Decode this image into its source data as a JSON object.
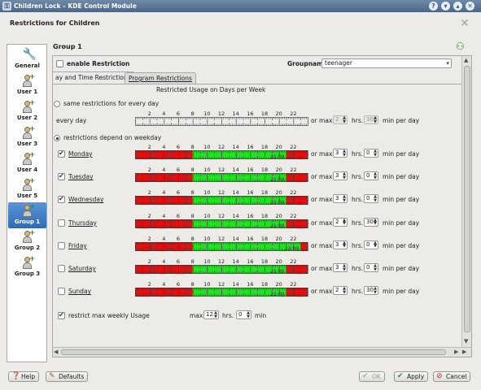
{
  "window": {
    "title": "Children Lock – KDE Control Module",
    "help_icon": "question-icon",
    "min_icon": "minimize-icon",
    "max_icon": "maximize-icon",
    "close_icon": "close-icon"
  },
  "header": {
    "title": "Restrictions for Children"
  },
  "sidebar": {
    "items": [
      {
        "label": "General",
        "icon": "wrench-icon",
        "active": false
      },
      {
        "label": "User 1",
        "icon": "user-add-icon",
        "active": false
      },
      {
        "label": "User 2",
        "icon": "user-add-icon",
        "active": false
      },
      {
        "label": "User 3",
        "icon": "user-add-icon",
        "active": false
      },
      {
        "label": "User 4",
        "icon": "user-add-icon",
        "active": false
      },
      {
        "label": "User 5",
        "icon": "user-add-icon",
        "active": false
      },
      {
        "label": "Group 1",
        "icon": "group-add-icon",
        "active": true
      },
      {
        "label": "Group 2",
        "icon": "group-add-icon",
        "active": false
      },
      {
        "label": "Group 3",
        "icon": "group-add-icon",
        "active": false
      }
    ]
  },
  "main": {
    "group_title": "Group 1",
    "enable_label": "enable Restriction",
    "enable_checked": false,
    "groupname_label": "Groupname",
    "groupname_value": "teenager",
    "tabs": [
      {
        "label": "ay and Time Restrictions",
        "active": true
      },
      {
        "label": "Program Restrictions",
        "active": false
      }
    ],
    "section_title": "Restricted Usage on Days per Week",
    "same_label": "same restrictions for every day",
    "same_checked": false,
    "every_day_label": "every day",
    "depend_label": "restrictions depend on weekday",
    "depend_checked": true,
    "ruler_ticks": [
      "2",
      "4",
      "6",
      "8",
      "10",
      "12",
      "14",
      "16",
      "18",
      "20",
      "22"
    ],
    "or_max": "or max",
    "hrs": "hrs.",
    "min_per_day": "min per day",
    "every_day": {
      "hours": "2",
      "minutes": "30"
    },
    "days": [
      {
        "label": "Monday",
        "checked": true,
        "allowed_from": 8,
        "allowed_to": 21,
        "end_label": "21:00",
        "hours": "3",
        "minutes": "0"
      },
      {
        "label": "Tuesday",
        "checked": true,
        "allowed_from": 8,
        "allowed_to": 21,
        "end_label": "21:00",
        "hours": "3",
        "minutes": "0"
      },
      {
        "label": "Wednesday",
        "checked": true,
        "allowed_from": 8,
        "allowed_to": 21,
        "end_label": "21:00",
        "hours": "3",
        "minutes": "0"
      },
      {
        "label": "Thursday",
        "checked": false,
        "allowed_from": 8,
        "allowed_to": 21,
        "end_label": "21:00",
        "hours": "2",
        "minutes": "30"
      },
      {
        "label": "Friday",
        "checked": false,
        "allowed_from": 8,
        "allowed_to": 23,
        "end_label": "23:00",
        "hours": "3",
        "minutes": "0"
      },
      {
        "label": "Saturday",
        "checked": false,
        "allowed_from": 8,
        "allowed_to": 21,
        "end_label": "21:00",
        "hours": "3",
        "minutes": "0"
      },
      {
        "label": "Sunday",
        "checked": false,
        "allowed_from": 8,
        "allowed_to": 21,
        "end_label": "21:00",
        "hours": "2",
        "minutes": "30"
      }
    ],
    "weekly_label": "restrict max weekly Usage",
    "weekly_checked": true,
    "weekly_max": "max",
    "weekly_hours": "12",
    "weekly_hrs": "hrs.",
    "weekly_minutes": "0",
    "weekly_min": "min",
    "colors": {
      "allowed": "#22e022",
      "restricted": "#e01010",
      "selection": "#3a7cd0"
    }
  },
  "footer": {
    "help": "Help",
    "defaults": "Defaults",
    "ok": "OK",
    "apply": "Apply",
    "cancel": "Cancel"
  }
}
